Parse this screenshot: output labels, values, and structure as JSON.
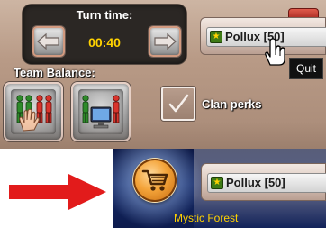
{
  "turn_time": {
    "title": "Turn time:",
    "value": "00:40",
    "decrease_icon": "arrow-left-icon",
    "increase_icon": "arrow-right-icon"
  },
  "team_balance": {
    "label": "Team Balance:",
    "options": [
      {
        "name": "manual-balance",
        "icon": "drag-hand-soldiers-icon"
      },
      {
        "name": "auto-balance",
        "icon": "computer-soldiers-icon"
      }
    ]
  },
  "clan_perks": {
    "label": "Clan perks",
    "checked": true
  },
  "player_top": {
    "name": "Pollux [50]",
    "rank_icon": "rank-badge-icon"
  },
  "tooltip": {
    "text": "Quit"
  },
  "player_bottom": {
    "name": "Pollux [50]",
    "rank_icon": "rank-badge-icon"
  },
  "shop": {
    "icon": "shopping-cart-icon"
  },
  "map": {
    "name": "Mystic Forest"
  },
  "colors": {
    "timer_value": "#ffd200",
    "map_name": "#ffd200",
    "callout_arrow": "#e21b1b",
    "shop_button": "#f4a43a"
  }
}
